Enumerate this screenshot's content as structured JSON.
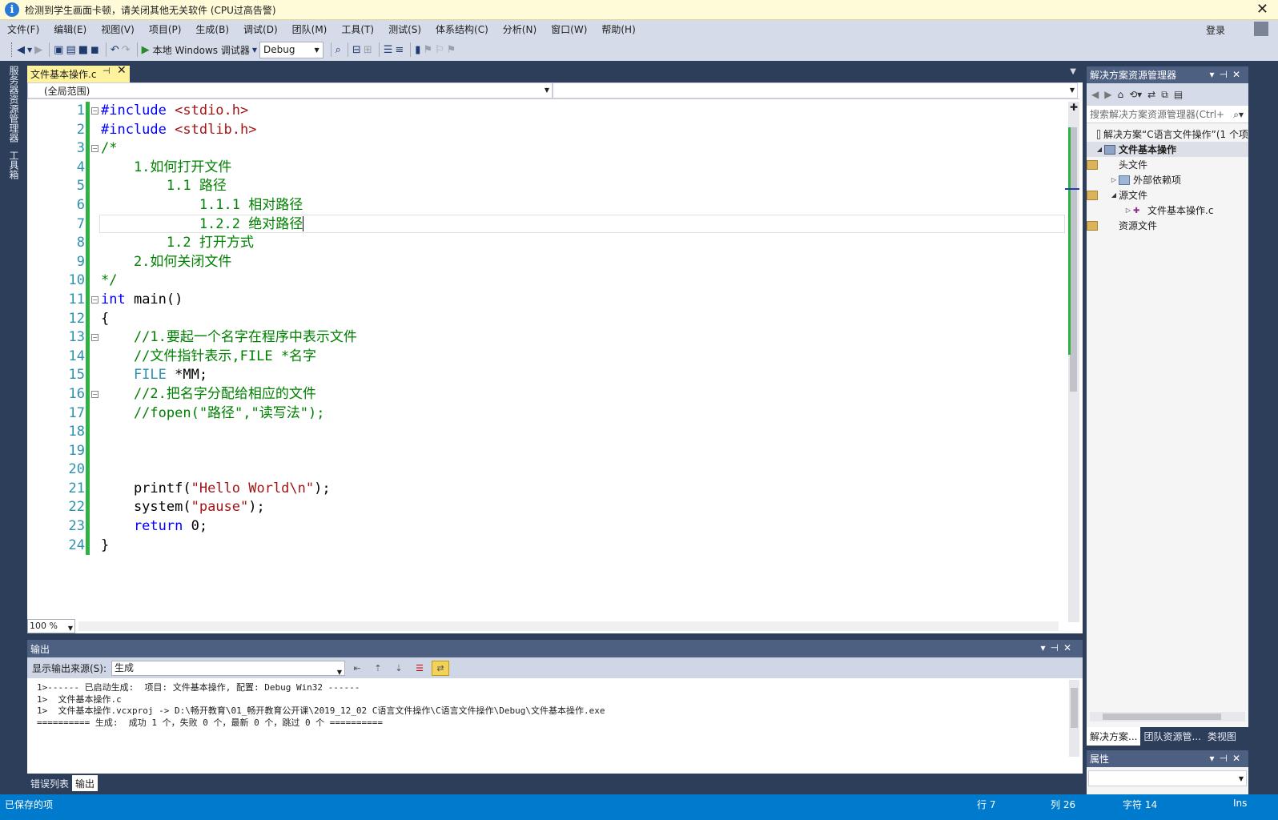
{
  "notification": {
    "message": "检测到学生画面卡顿，请关闭其他无关软件 (CPU过高告警)"
  },
  "menu": {
    "items": [
      "文件(F)",
      "编辑(E)",
      "视图(V)",
      "项目(P)",
      "生成(B)",
      "调试(D)",
      "团队(M)",
      "工具(T)",
      "测试(S)",
      "体系结构(C)",
      "分析(N)",
      "窗口(W)",
      "帮助(H)"
    ],
    "login": "登录"
  },
  "toolbar": {
    "run_label": "本地 Windows 调试器",
    "config": "Debug"
  },
  "vertical_tabs": [
    "服务器资源管理器",
    "工具箱"
  ],
  "document": {
    "tab_label": "文件基本操作.c",
    "scope": "(全局范围)",
    "zoom": "100 %"
  },
  "code": {
    "lines": [
      {
        "n": "1",
        "parts": [
          [
            "pp",
            "#include "
          ],
          [
            "str",
            "<stdio.h>"
          ]
        ]
      },
      {
        "n": "2",
        "parts": [
          [
            "pp",
            "#include "
          ],
          [
            "str",
            "<stdlib.h>"
          ]
        ]
      },
      {
        "n": "3",
        "parts": [
          [
            "cmt",
            "/*"
          ]
        ]
      },
      {
        "n": "4",
        "parts": [
          [
            "cmt",
            "    1.如何打开文件"
          ]
        ]
      },
      {
        "n": "5",
        "parts": [
          [
            "cmt",
            "        1.1 路径"
          ]
        ]
      },
      {
        "n": "6",
        "parts": [
          [
            "cmt",
            "            1.1.1 相对路径"
          ]
        ]
      },
      {
        "n": "7",
        "parts": [
          [
            "cmt",
            "            1.2.2 绝对路径"
          ]
        ]
      },
      {
        "n": "8",
        "parts": [
          [
            "cmt",
            "        1.2 打开方式"
          ]
        ]
      },
      {
        "n": "9",
        "parts": [
          [
            "cmt",
            "    2.如何关闭文件"
          ]
        ]
      },
      {
        "n": "10",
        "parts": [
          [
            "cmt",
            "*/"
          ]
        ]
      },
      {
        "n": "11",
        "parts": [
          [
            "kw",
            "int"
          ],
          [
            "",
            " main()"
          ]
        ]
      },
      {
        "n": "12",
        "parts": [
          [
            "",
            "{"
          ]
        ]
      },
      {
        "n": "13",
        "parts": [
          [
            "cmt",
            "    //1.要起一个名字在程序中表示文件"
          ]
        ]
      },
      {
        "n": "14",
        "parts": [
          [
            "cmt",
            "    //文件指针表示,FILE *名字"
          ]
        ]
      },
      {
        "n": "15",
        "parts": [
          [
            "ty",
            "    FILE"
          ],
          [
            "",
            " *MM;"
          ]
        ]
      },
      {
        "n": "16",
        "parts": [
          [
            "cmt",
            "    //2.把名字分配给相应的文件"
          ]
        ]
      },
      {
        "n": "17",
        "parts": [
          [
            "cmt",
            "    //fopen(\"路径\",\"读写法\");"
          ]
        ]
      },
      {
        "n": "18",
        "parts": [
          [
            "",
            ""
          ]
        ]
      },
      {
        "n": "19",
        "parts": [
          [
            "",
            ""
          ]
        ]
      },
      {
        "n": "20",
        "parts": [
          [
            "",
            ""
          ]
        ]
      },
      {
        "n": "21",
        "parts": [
          [
            "",
            "    printf("
          ],
          [
            "str",
            "\"Hello World\\n\""
          ],
          [
            "",
            ");"
          ]
        ]
      },
      {
        "n": "22",
        "parts": [
          [
            "",
            "    system("
          ],
          [
            "str",
            "\"pause\""
          ],
          [
            "",
            ");"
          ]
        ]
      },
      {
        "n": "23",
        "parts": [
          [
            "kw",
            "    return"
          ],
          [
            "",
            " 0;"
          ]
        ]
      },
      {
        "n": "24",
        "parts": [
          [
            "",
            "}"
          ]
        ]
      }
    ]
  },
  "output": {
    "title": "输出",
    "source_label": "显示输出来源(S):",
    "source_value": "生成",
    "lines": [
      "1>------ 已启动生成:  项目: 文件基本操作, 配置: Debug Win32 ------",
      "1>  文件基本操作.c",
      "1>  文件基本操作.vcxproj -> D:\\畅开教育\\01_畅开教育公开课\\2019_12_02 C语言文件操作\\C语言文件操作\\Debug\\文件基本操作.exe",
      "========== 生成:  成功 1 个，失败 0 个，最新 0 个，跳过 0 个 =========="
    ]
  },
  "bottom_tabs": [
    "错误列表",
    "输出"
  ],
  "solution": {
    "title": "解决方案资源管理器",
    "search_placeholder": "搜索解决方案资源管理器(Ctrl+",
    "tree": [
      {
        "label": "解决方案“C语言文件操作”(1 个项",
        "indent": 0,
        "twist": "",
        "icon": "sln"
      },
      {
        "label": "文件基本操作",
        "indent": 0,
        "twist": "◢",
        "icon": "proj",
        "selected": true
      },
      {
        "label": "头文件",
        "indent": 1,
        "twist": "",
        "icon": "fold"
      },
      {
        "label": "外部依赖项",
        "indent": 1,
        "twist": "▷",
        "icon": "ref"
      },
      {
        "label": "源文件",
        "indent": 1,
        "twist": "◢",
        "icon": "fold"
      },
      {
        "label": "文件基本操作.c",
        "indent": 2,
        "twist": "▷",
        "icon": "cf"
      },
      {
        "label": "资源文件",
        "indent": 1,
        "twist": "",
        "icon": "fold"
      }
    ],
    "tabs": [
      "解决方案...",
      "团队资源管...",
      "类视图"
    ]
  },
  "properties": {
    "title": "属性"
  },
  "status": {
    "left": "已保存的项",
    "row": "行 7",
    "col": "列 26",
    "ch": "字符 14",
    "ins": "Ins"
  }
}
